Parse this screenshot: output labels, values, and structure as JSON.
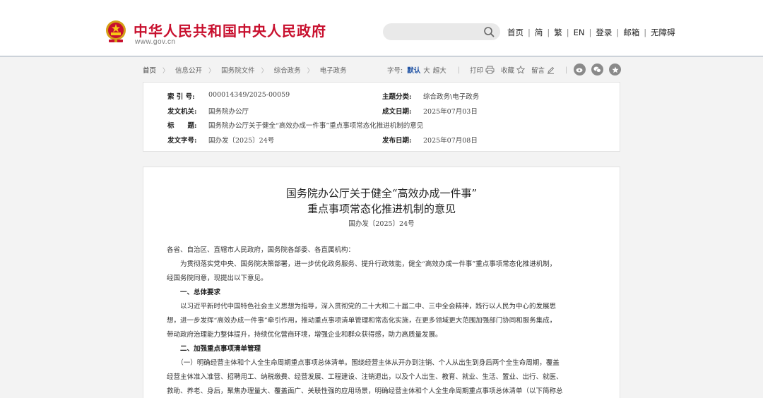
{
  "header": {
    "site_title": "中华人民共和国中央人民政府",
    "site_url": "www.gov.cn",
    "search": {
      "placeholder": "",
      "value": ""
    },
    "nav": [
      "首页",
      "简",
      "繁",
      "EN",
      "登录",
      "邮箱",
      "无障碍"
    ]
  },
  "breadcrumb": [
    "首页",
    "信息公开",
    "国务院文件",
    "综合政务",
    "电子政务"
  ],
  "toolbar": {
    "font_size_label": "字号:",
    "font_sizes": [
      "默认",
      "大",
      "超大"
    ],
    "active_font_size": "默认",
    "print": "打印",
    "favorite": "收藏",
    "comment": "留言"
  },
  "share_icons": [
    "weibo-icon",
    "wechat-icon",
    "qzone-icon"
  ],
  "info": {
    "index_label": "索 引 号:",
    "index_value": "000014349/2025-00059",
    "category_label": "主题分类:",
    "category_value": "综合政务\\电子政务",
    "issuer_label": "发文机关:",
    "issuer_value": "国务院办公厅",
    "date_written_label": "成文日期:",
    "date_written_value": "2025年07月03日",
    "title_label": "标　　题:",
    "title_value": "国务院办公厅关于健全“高效办成一件事”重点事项常态化推进机制的意见",
    "doc_no_label": "发文字号:",
    "doc_no_value": "国办发〔2025〕24号",
    "publish_label": "发布日期:",
    "publish_value": "2025年07月08日"
  },
  "document": {
    "title_line1": "国务院办公厅关于健全“高效办成一件事”",
    "title_line2": "重点事项常态化推进机制的意见",
    "doc_number": "国办发〔2025〕24号",
    "paragraphs": [
      "各省、自治区、直辖市人民政府，国务院各部委、各直属机构：",
      "　　为贯彻落实党中央、国务院决策部署，进一步优化政务服务、提升行政效能，健全“高效办成一件事”重点事项常态化推进机制，",
      "经国务院同意，现提出以下意见。",
      "　　一、总体要求",
      "　　以习近平新时代中国特色社会主义思想为指导，深入贯彻党的二十大和二十届二中、三中全会精神，践行以人民为中心的发展思",
      "想，进一步发挥“高效办成一件事”牵引作用，推动重点事项清单管理和常态化实施，在更多领域更大范围加强部门协同和服务集成，",
      "带动政府治理能力整体提升，持续优化营商环境，增强企业和群众获得感，助力高质量发展。",
      "　　二、加强重点事项清单管理",
      "　　（一）明确经营主体和个人全生命周期重点事项总体清单。围绕经营主体从开办到注销、个人从出生到身后两个全生命周期，覆盖",
      "经营主体准入准营、招聘用工、纳税缴费、经营发展、工程建设、注销退出，以及个人出生、教育、就业、生活、置业、出行、就医、",
      "救助、养老、身后，聚焦办理量大、覆盖面广、关联性强的应用场景，明确经营主体和个人全生命周期重点事项总体清单（以下简称总"
    ]
  }
}
